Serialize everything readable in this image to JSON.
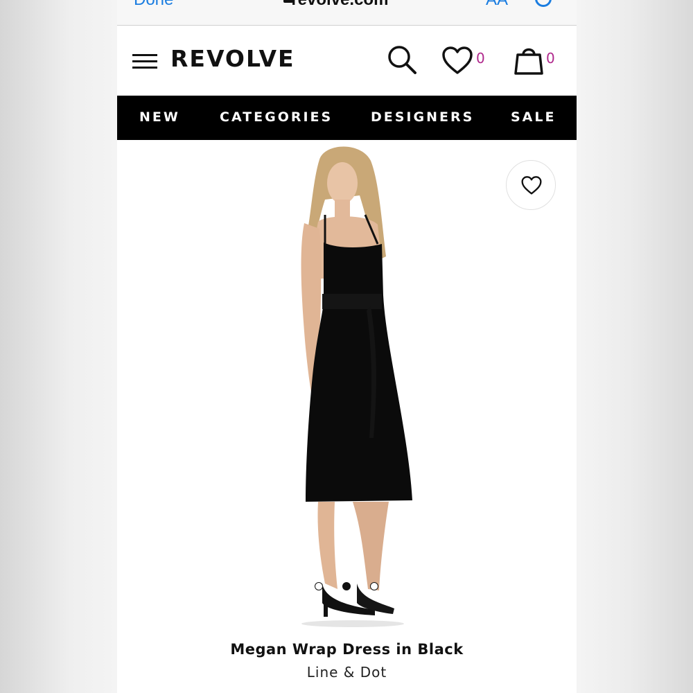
{
  "safari": {
    "done_label": "Done",
    "url": "revolve.com",
    "aa_label": "AA"
  },
  "header": {
    "logo": "REVOLVE",
    "wishlist_count": "0",
    "bag_count": "0"
  },
  "nav": {
    "items": [
      "NEW",
      "CATEGORIES",
      "DESIGNERS",
      "SALE"
    ]
  },
  "product": {
    "name": "Megan Wrap Dress in Black",
    "brand": "Line & Dot",
    "image_count": 3,
    "active_image": 2
  },
  "colors": {
    "accent_count": "#b0288c",
    "nav_bg": "#000000",
    "safari_blue": "#1b7de0"
  }
}
